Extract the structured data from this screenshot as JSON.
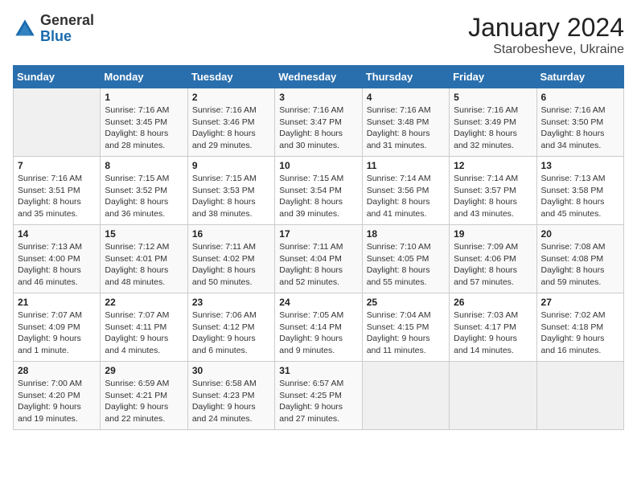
{
  "header": {
    "logo_general": "General",
    "logo_blue": "Blue",
    "month_year": "January 2024",
    "location": "Starobesheve, Ukraine"
  },
  "days_of_week": [
    "Sunday",
    "Monday",
    "Tuesday",
    "Wednesday",
    "Thursday",
    "Friday",
    "Saturday"
  ],
  "weeks": [
    [
      {
        "day": "",
        "info": ""
      },
      {
        "day": "1",
        "info": "Sunrise: 7:16 AM\nSunset: 3:45 PM\nDaylight: 8 hours\nand 28 minutes."
      },
      {
        "day": "2",
        "info": "Sunrise: 7:16 AM\nSunset: 3:46 PM\nDaylight: 8 hours\nand 29 minutes."
      },
      {
        "day": "3",
        "info": "Sunrise: 7:16 AM\nSunset: 3:47 PM\nDaylight: 8 hours\nand 30 minutes."
      },
      {
        "day": "4",
        "info": "Sunrise: 7:16 AM\nSunset: 3:48 PM\nDaylight: 8 hours\nand 31 minutes."
      },
      {
        "day": "5",
        "info": "Sunrise: 7:16 AM\nSunset: 3:49 PM\nDaylight: 8 hours\nand 32 minutes."
      },
      {
        "day": "6",
        "info": "Sunrise: 7:16 AM\nSunset: 3:50 PM\nDaylight: 8 hours\nand 34 minutes."
      }
    ],
    [
      {
        "day": "7",
        "info": "Sunrise: 7:16 AM\nSunset: 3:51 PM\nDaylight: 8 hours\nand 35 minutes."
      },
      {
        "day": "8",
        "info": "Sunrise: 7:15 AM\nSunset: 3:52 PM\nDaylight: 8 hours\nand 36 minutes."
      },
      {
        "day": "9",
        "info": "Sunrise: 7:15 AM\nSunset: 3:53 PM\nDaylight: 8 hours\nand 38 minutes."
      },
      {
        "day": "10",
        "info": "Sunrise: 7:15 AM\nSunset: 3:54 PM\nDaylight: 8 hours\nand 39 minutes."
      },
      {
        "day": "11",
        "info": "Sunrise: 7:14 AM\nSunset: 3:56 PM\nDaylight: 8 hours\nand 41 minutes."
      },
      {
        "day": "12",
        "info": "Sunrise: 7:14 AM\nSunset: 3:57 PM\nDaylight: 8 hours\nand 43 minutes."
      },
      {
        "day": "13",
        "info": "Sunrise: 7:13 AM\nSunset: 3:58 PM\nDaylight: 8 hours\nand 45 minutes."
      }
    ],
    [
      {
        "day": "14",
        "info": "Sunrise: 7:13 AM\nSunset: 4:00 PM\nDaylight: 8 hours\nand 46 minutes."
      },
      {
        "day": "15",
        "info": "Sunrise: 7:12 AM\nSunset: 4:01 PM\nDaylight: 8 hours\nand 48 minutes."
      },
      {
        "day": "16",
        "info": "Sunrise: 7:11 AM\nSunset: 4:02 PM\nDaylight: 8 hours\nand 50 minutes."
      },
      {
        "day": "17",
        "info": "Sunrise: 7:11 AM\nSunset: 4:04 PM\nDaylight: 8 hours\nand 52 minutes."
      },
      {
        "day": "18",
        "info": "Sunrise: 7:10 AM\nSunset: 4:05 PM\nDaylight: 8 hours\nand 55 minutes."
      },
      {
        "day": "19",
        "info": "Sunrise: 7:09 AM\nSunset: 4:06 PM\nDaylight: 8 hours\nand 57 minutes."
      },
      {
        "day": "20",
        "info": "Sunrise: 7:08 AM\nSunset: 4:08 PM\nDaylight: 8 hours\nand 59 minutes."
      }
    ],
    [
      {
        "day": "21",
        "info": "Sunrise: 7:07 AM\nSunset: 4:09 PM\nDaylight: 9 hours\nand 1 minute."
      },
      {
        "day": "22",
        "info": "Sunrise: 7:07 AM\nSunset: 4:11 PM\nDaylight: 9 hours\nand 4 minutes."
      },
      {
        "day": "23",
        "info": "Sunrise: 7:06 AM\nSunset: 4:12 PM\nDaylight: 9 hours\nand 6 minutes."
      },
      {
        "day": "24",
        "info": "Sunrise: 7:05 AM\nSunset: 4:14 PM\nDaylight: 9 hours\nand 9 minutes."
      },
      {
        "day": "25",
        "info": "Sunrise: 7:04 AM\nSunset: 4:15 PM\nDaylight: 9 hours\nand 11 minutes."
      },
      {
        "day": "26",
        "info": "Sunrise: 7:03 AM\nSunset: 4:17 PM\nDaylight: 9 hours\nand 14 minutes."
      },
      {
        "day": "27",
        "info": "Sunrise: 7:02 AM\nSunset: 4:18 PM\nDaylight: 9 hours\nand 16 minutes."
      }
    ],
    [
      {
        "day": "28",
        "info": "Sunrise: 7:00 AM\nSunset: 4:20 PM\nDaylight: 9 hours\nand 19 minutes."
      },
      {
        "day": "29",
        "info": "Sunrise: 6:59 AM\nSunset: 4:21 PM\nDaylight: 9 hours\nand 22 minutes."
      },
      {
        "day": "30",
        "info": "Sunrise: 6:58 AM\nSunset: 4:23 PM\nDaylight: 9 hours\nand 24 minutes."
      },
      {
        "day": "31",
        "info": "Sunrise: 6:57 AM\nSunset: 4:25 PM\nDaylight: 9 hours\nand 27 minutes."
      },
      {
        "day": "",
        "info": ""
      },
      {
        "day": "",
        "info": ""
      },
      {
        "day": "",
        "info": ""
      }
    ]
  ]
}
